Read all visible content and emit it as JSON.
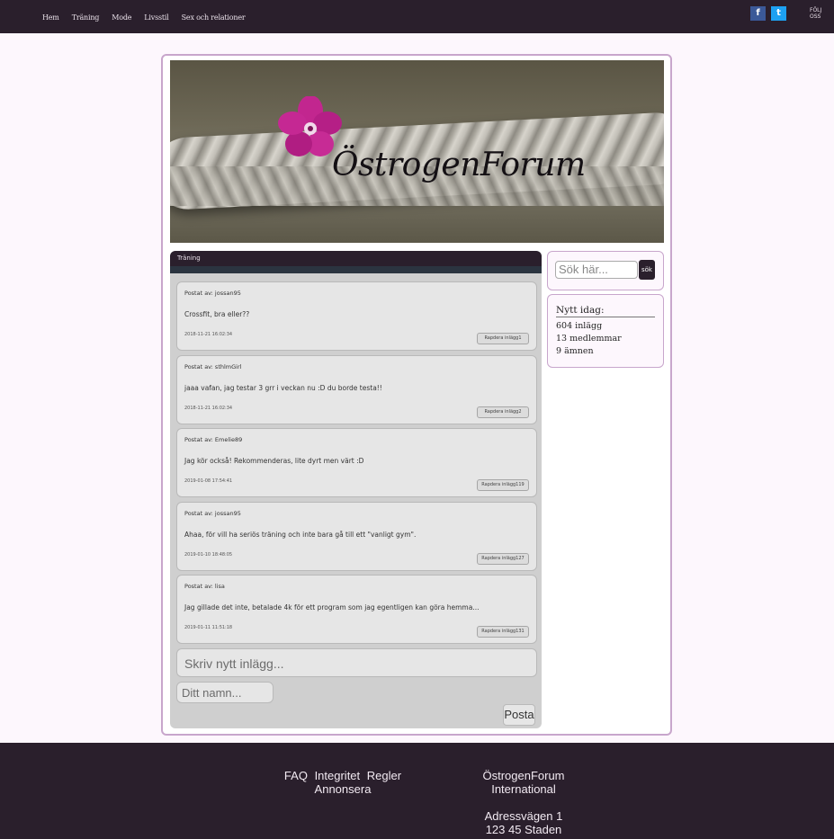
{
  "nav": {
    "items": [
      "Hem",
      "Träning",
      "Mode",
      "Livsstil",
      "Sex och relationer"
    ],
    "follow": "FÖLJ OSS"
  },
  "social": [
    {
      "icon": "facebook-icon",
      "glyph": "f",
      "color": "#3b5998"
    },
    {
      "icon": "twitter-icon",
      "glyph": "t",
      "color": "#1da1f2"
    }
  ],
  "banner": {
    "title": "ÖstrogenForum"
  },
  "forum": {
    "category": "Träning",
    "posts": [
      {
        "author": "Postat av: jossan95",
        "text": "Crossfit, bra eller??",
        "timestamp": "2018-11-21 16:02:34",
        "report": "Rapdera inlägg1"
      },
      {
        "author": "Postat av: sthlmGirl",
        "text": "jaaa vafan, jag testar 3 grr i veckan nu :D du borde testa!!",
        "timestamp": "2018-11-21 16:02:34",
        "report": "Rapdera inlägg2"
      },
      {
        "author": "Postat av: Emelie89",
        "text": "Jag kör också! Rekommenderas, lite dyrt men värt :D",
        "timestamp": "2019-01-08 17:54:41",
        "report": "Rapdera inlägg119"
      },
      {
        "author": "Postat av: jossan95",
        "text": "Ahaa, för vill ha seriös träning och inte bara gå till ett \"vanligt gym\".",
        "timestamp": "2019-01-10 18:48:05",
        "report": "Rapdera inlägg127"
      },
      {
        "author": "Postat av: lisa",
        "text": "Jag gillade det inte, betalade 4k för ett program som jag egentligen kan göra hemma...",
        "timestamp": "2019-01-11 11:51:18",
        "report": "Rapdera inlägg131"
      }
    ],
    "new_post_placeholder": "Skriv nytt inlägg...",
    "name_placeholder": "Ditt namn...",
    "submit_label": "Posta"
  },
  "search": {
    "placeholder": "Sök här...",
    "button": "sök"
  },
  "stats": {
    "title": "Nytt idag:",
    "posts": "604 inlägg",
    "members": "13 medlemmar",
    "topics": "9 ämnen"
  },
  "footer": {
    "links": [
      "FAQ",
      "Integritet",
      "Regler",
      "Annonsera"
    ],
    "org_line1": "ÖstrogenForum",
    "org_line2": "International",
    "addr_line1": "Adressvägen 1",
    "addr_line2": "123 45 Staden"
  },
  "colors": {
    "dark": "#2a1f2c",
    "accent_border": "#c8a6cc",
    "panel": "#cfcfcf"
  }
}
